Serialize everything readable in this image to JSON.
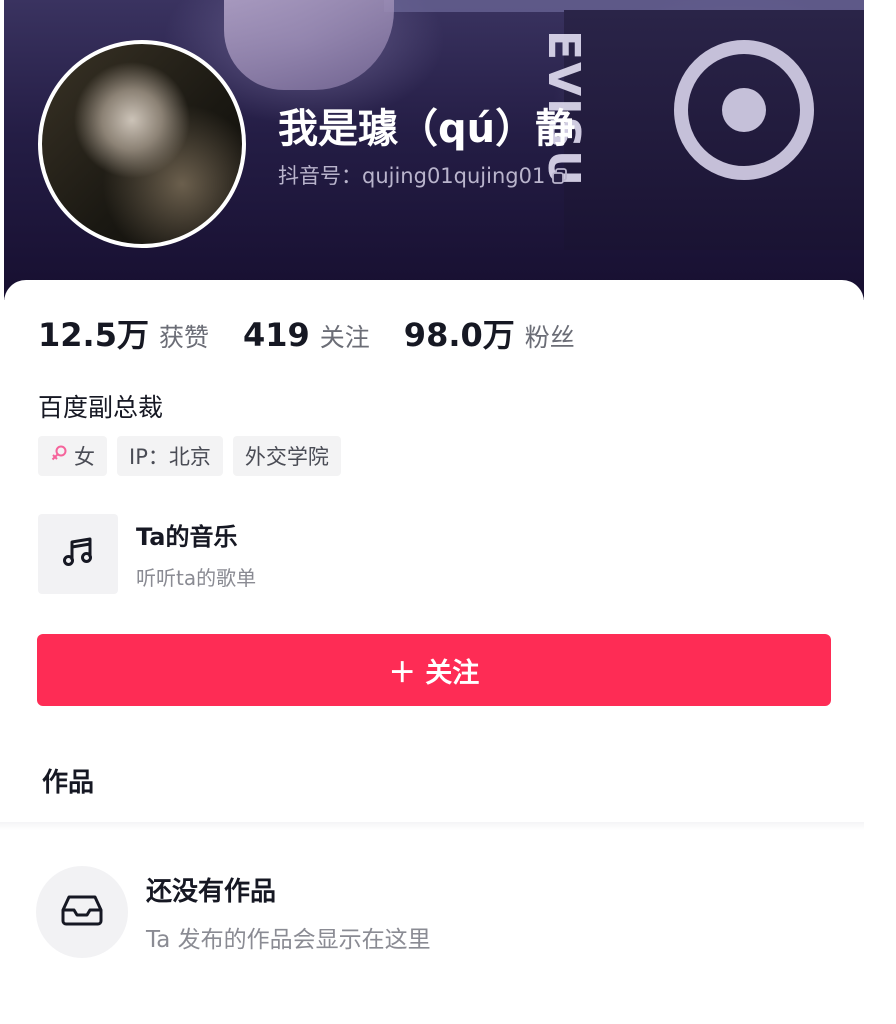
{
  "profile": {
    "nickname": "我是璩（qú）静",
    "douyin_id": "抖音号：qujing01qujing01",
    "banner_logo_text": "EVISU"
  },
  "stats": [
    {
      "value": "12.5万",
      "label": "获赞"
    },
    {
      "value": "419",
      "label": "关注"
    },
    {
      "value": "98.0万",
      "label": "粉丝"
    }
  ],
  "bio": "百度副总裁",
  "tags": {
    "gender": "女",
    "ip": "IP：北京",
    "school": "外交学院"
  },
  "music": {
    "title": "Ta的音乐",
    "subtitle": "听听ta的歌单"
  },
  "follow_button": {
    "label": "＋ 关注"
  },
  "works": {
    "title": "作品",
    "empty_title": "还没有作品",
    "empty_subtitle": "Ta 发布的作品会显示在这里"
  },
  "colors": {
    "accent": "#fe2c55",
    "gender_icon": "#f5639b"
  },
  "icons": {
    "copy": "copy-icon",
    "gender": "female-icon",
    "music": "music-note-icon",
    "empty": "inbox-tray-icon"
  }
}
